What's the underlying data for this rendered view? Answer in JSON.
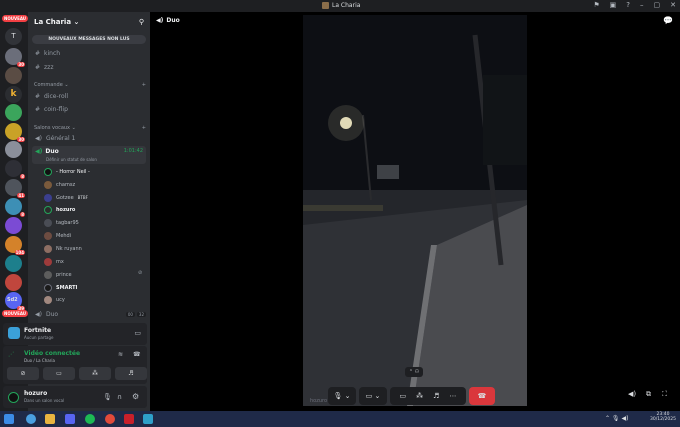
{
  "window": {
    "title": "La Charia"
  },
  "server_rail": {
    "nouveau_top": "NOUVEAU",
    "nouveau_bottom": "NOUVEAU",
    "letter_server": "T",
    "sd2_label": "Sd2",
    "badges": [
      "30",
      "30",
      "8",
      "41",
      "8",
      "104",
      "39"
    ]
  },
  "sidebar": {
    "guild_name": "La Charia",
    "unread_banner": "NOUVEAUX MESSAGES NON LUS",
    "text_channels_top": [
      {
        "name": "kinch"
      },
      {
        "name": "zzz"
      }
    ],
    "category_commande": "Commande",
    "commande_channels": [
      "dice-roll",
      "coin-flip"
    ],
    "category_voice": "Salons vocaux",
    "voice_general": "Général 1",
    "voice_duo": "Duo ",
    "voice_duo_timer": "1:01:42",
    "voice_status_placeholder": "Définir un statut de salon",
    "voice_users": [
      "- Horror Neil -",
      "chamsz",
      "Gotzee",
      "hozuro",
      "tagbar95",
      "Mehdi",
      "Nk ruyann",
      "mx",
      "prince",
      "SMARTI",
      "ucy"
    ],
    "gotzee_tag": "BTBF",
    "duo_bottom": "Duo ",
    "duo_bottom_counts": [
      "00",
      "32"
    ]
  },
  "activity_panel": {
    "game": "Fortnite",
    "game_sub": "Aucun partage"
  },
  "voice_panel": {
    "status": "Vidéo connectée",
    "location": "Duo  / La Charia"
  },
  "user_panel": {
    "username": "hozuro",
    "substatus": "Dans un salon vocal"
  },
  "stage": {
    "channel_label": "Duo ",
    "user_label": "hozuro"
  },
  "taskbar": {
    "time": "23:40",
    "date": "30/12/2025"
  },
  "colors": {
    "green": "#23a55a",
    "red": "#da373c",
    "blurple": "#5865f2",
    "voice_timer": "#23a55a"
  }
}
